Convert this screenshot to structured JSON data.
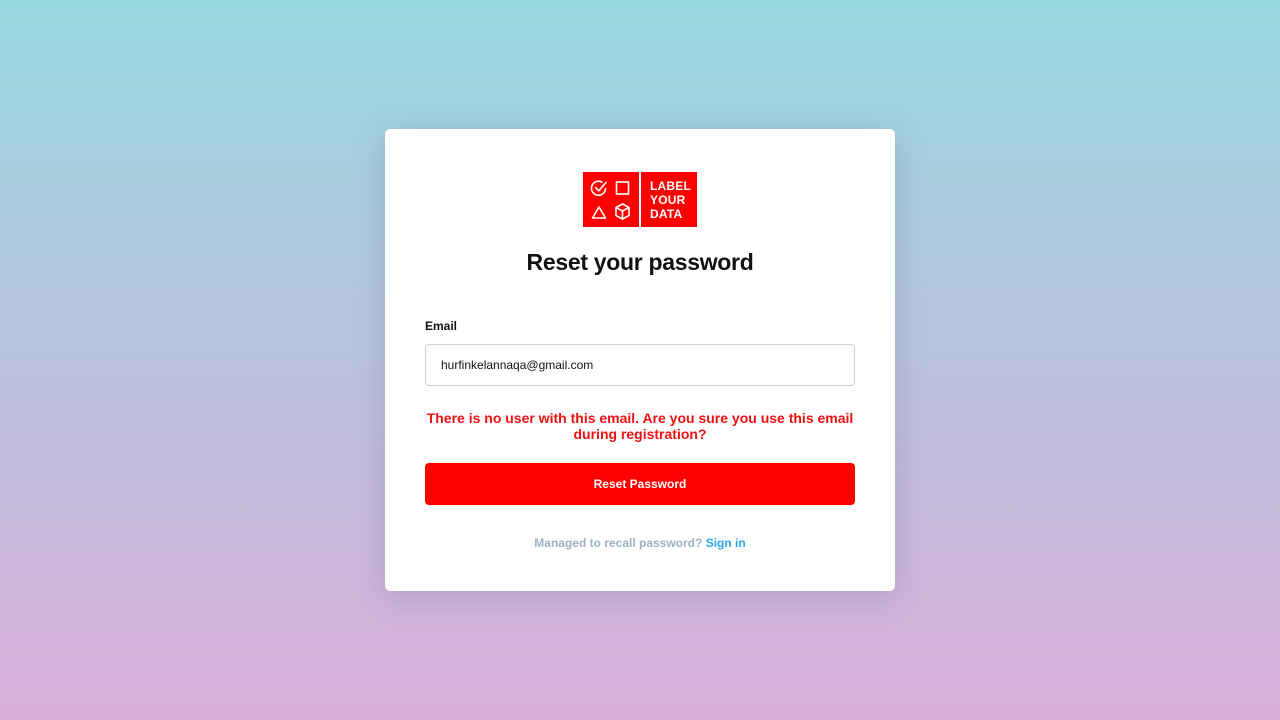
{
  "brand": {
    "logo_lines": [
      "LABEL",
      "YOUR",
      "DATA"
    ],
    "icons": [
      "check-circle-icon",
      "square-icon",
      "triangle-icon",
      "cube-icon"
    ],
    "color": "#ff0000"
  },
  "form": {
    "title": "Reset your password",
    "email_label": "Email",
    "email_value": "hurfinkelannaqa@gmail.com",
    "error_message": "There is no user with this email. Are you sure you use this email during registration?",
    "error_color": "#ee1111",
    "submit_label": "Reset Password"
  },
  "footer": {
    "prompt": "Managed to recall password?",
    "link_label": "Sign in",
    "link_color": "#2aa6e8"
  }
}
